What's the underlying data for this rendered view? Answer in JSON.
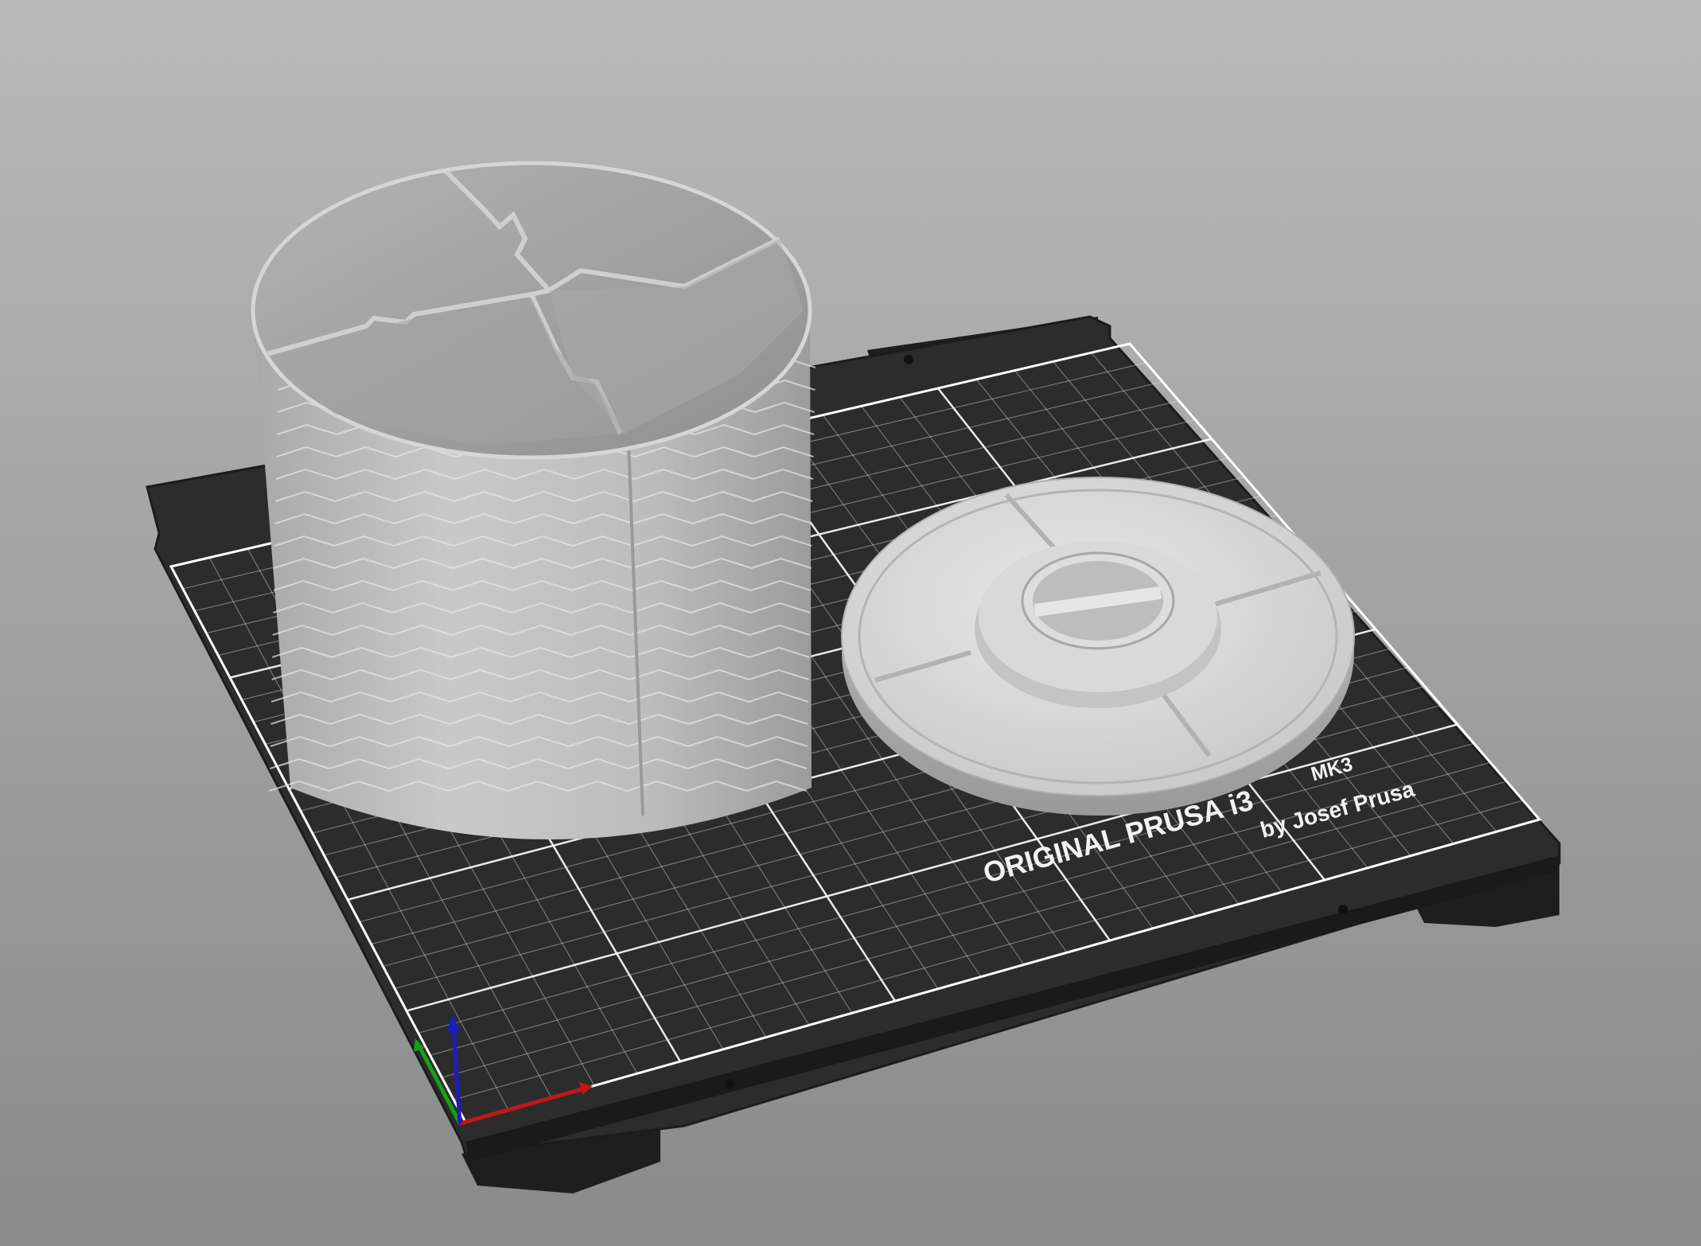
{
  "bed": {
    "brand": "ORIGINAL PRUSA i3",
    "model": "MK3",
    "byline": "by Josef Prusa"
  },
  "objects": [
    {
      "name": "divided cylinder container"
    },
    {
      "name": "round lid"
    }
  ],
  "axes": {
    "x_color": "#c01818",
    "y_color": "#17a017",
    "z_color": "#1c1cc0"
  },
  "colors": {
    "background_top": "#b8b8b8",
    "background_bottom": "#8c8c8c",
    "bed": "#2c2c2c",
    "grid": "#ffffff",
    "model": "#cfcfcf"
  }
}
